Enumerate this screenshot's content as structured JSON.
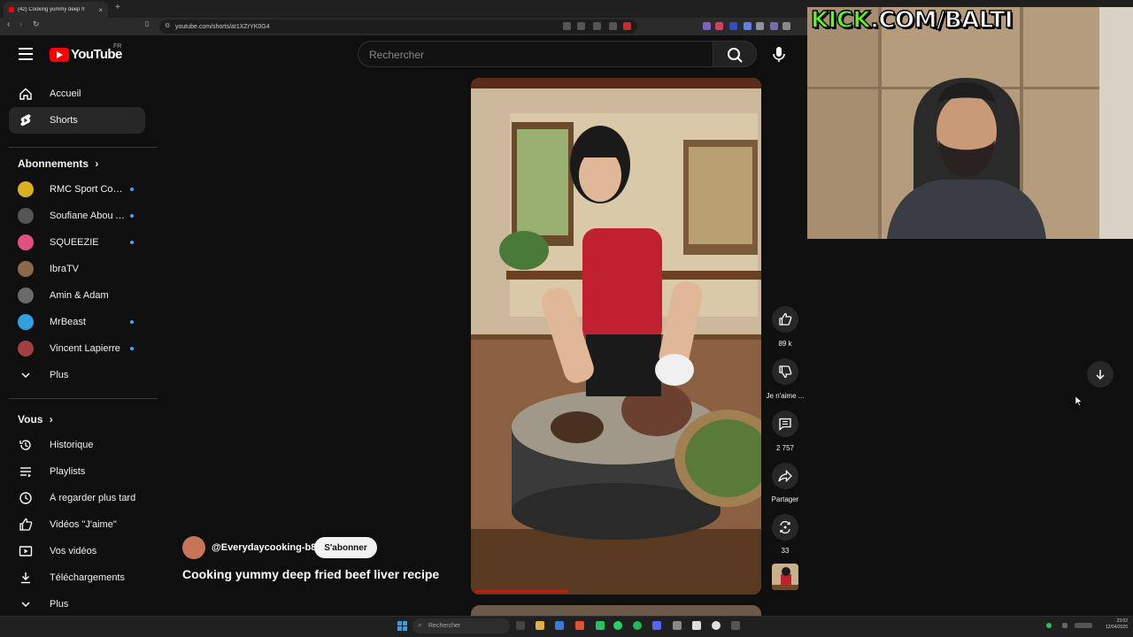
{
  "browser": {
    "tab_title": "(42) Cooking yummy deep fr",
    "url": "youtube.com/shorts/aI1XZrYK0G4",
    "new_tab": "+"
  },
  "header": {
    "logo_text": "YouTube",
    "country": "FR",
    "search_placeholder": "Rechercher"
  },
  "sidebar": {
    "main": [
      {
        "label": "Accueil",
        "icon": "home-icon"
      },
      {
        "label": "Shorts",
        "icon": "shorts-icon",
        "active": true
      }
    ],
    "subscriptions_title": "Abonnements",
    "subscriptions": [
      {
        "label": "RMC Sport Com...",
        "dot": true,
        "color": "#d8b020"
      },
      {
        "label": "Soufiane Abou A...",
        "dot": true,
        "color": "#555555"
      },
      {
        "label": "SQUEEZIE",
        "dot": true,
        "color": "#e05080"
      },
      {
        "label": "IbraTV",
        "dot": false,
        "color": "#8a6a4a"
      },
      {
        "label": "Amin & Adam",
        "dot": false,
        "color": "#6a6a6a"
      },
      {
        "label": "MrBeast",
        "dot": true,
        "color": "#30a0e0"
      },
      {
        "label": "Vincent Lapierre",
        "dot": true,
        "color": "#a04040"
      }
    ],
    "subscriptions_more": "Plus",
    "you_title": "Vous",
    "you": [
      {
        "label": "Historique",
        "icon": "history-icon"
      },
      {
        "label": "Playlists",
        "icon": "playlist-icon"
      },
      {
        "label": "À regarder plus tard",
        "icon": "clock-icon"
      },
      {
        "label": "Vidéos \"J'aime\"",
        "icon": "thumb-up-icon"
      },
      {
        "label": "Vos vidéos",
        "icon": "video-icon"
      },
      {
        "label": "Téléchargements",
        "icon": "download-icon"
      }
    ],
    "you_more": "Plus"
  },
  "short": {
    "channel": "@Everydaycooking-b8e",
    "subscribe_label": "S'abonner",
    "title": "Cooking yummy deep fried beef liver recipe",
    "progress_fraction": 0.33,
    "actions": {
      "likes": "89 k",
      "dislike": "Je n'aime ...",
      "comments": "2 757",
      "share": "Partager",
      "remix": "33"
    }
  },
  "overlay": {
    "kick_prefix": "KICK",
    "kick_suffix": ".COM/BALTI"
  },
  "taskbar": {
    "search_placeholder": "Rechercher",
    "time": "23:02",
    "date": "12/04/2026"
  },
  "colors": {
    "accent": "#ff0000",
    "background": "#0f0f0f",
    "kick_green": "#53fc18",
    "dot_blue": "#3ea6ff"
  }
}
